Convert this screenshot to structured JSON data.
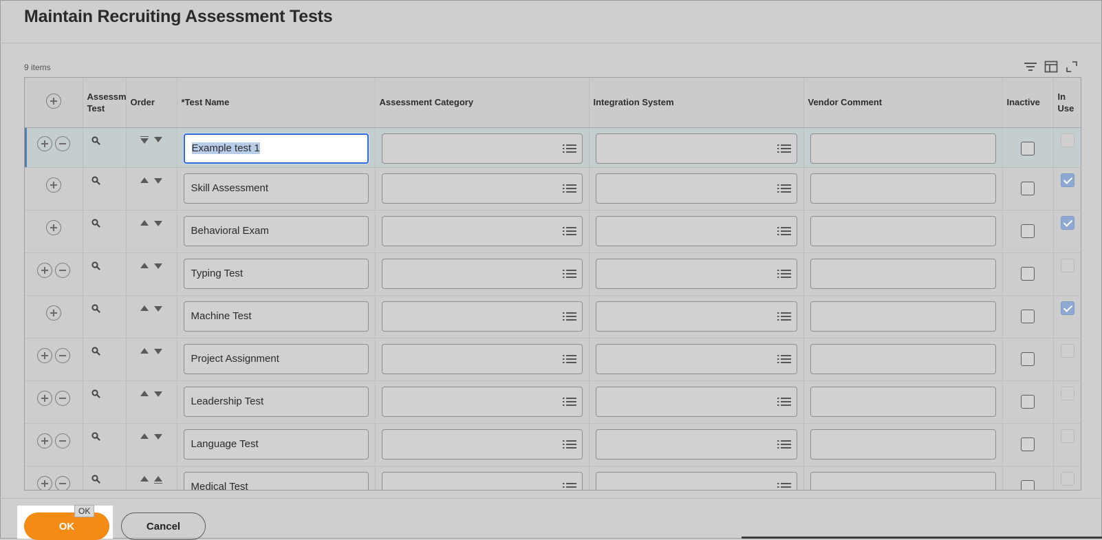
{
  "page": {
    "title": "Maintain Recruiting Assessment Tests",
    "items_count": "9 items"
  },
  "toolbar": {
    "icons": [
      "filter-icon",
      "columns-icon",
      "fullscreen-icon"
    ]
  },
  "columns": {
    "assessment_test": "Assessment Test",
    "order": "Order",
    "test_name": "*Test Name",
    "assessment_category": "Assessment Category",
    "integration_system": "Integration System",
    "vendor_comment": "Vendor Comment",
    "inactive": "Inactive",
    "in_use": "In Use"
  },
  "rows": [
    {
      "test_name": "Example test 1",
      "active": true,
      "removable": true,
      "in_use": false,
      "order": "top"
    },
    {
      "test_name": "Skill Assessment",
      "removable": false,
      "in_use": true,
      "order": "middle"
    },
    {
      "test_name": "Behavioral Exam",
      "removable": false,
      "in_use": true,
      "order": "middle"
    },
    {
      "test_name": "Typing Test",
      "removable": true,
      "in_use": false,
      "order": "middle"
    },
    {
      "test_name": "Machine Test",
      "removable": false,
      "in_use": true,
      "order": "middle"
    },
    {
      "test_name": "Project Assignment",
      "removable": true,
      "in_use": false,
      "order": "middle"
    },
    {
      "test_name": "Leadership Test",
      "removable": true,
      "in_use": false,
      "order": "middle"
    },
    {
      "test_name": "Language Test",
      "removable": true,
      "in_use": false,
      "order": "middle"
    },
    {
      "test_name": "Medical Test",
      "removable": true,
      "in_use": false,
      "order": "bottom"
    }
  ],
  "footer": {
    "ok_label": "OK",
    "ok_tooltip": "OK",
    "cancel_label": "Cancel"
  },
  "colors": {
    "primary_button": "#f38b14",
    "active_field_border": "#2d6fd1",
    "checked_in_use": "#8ea9d1"
  }
}
